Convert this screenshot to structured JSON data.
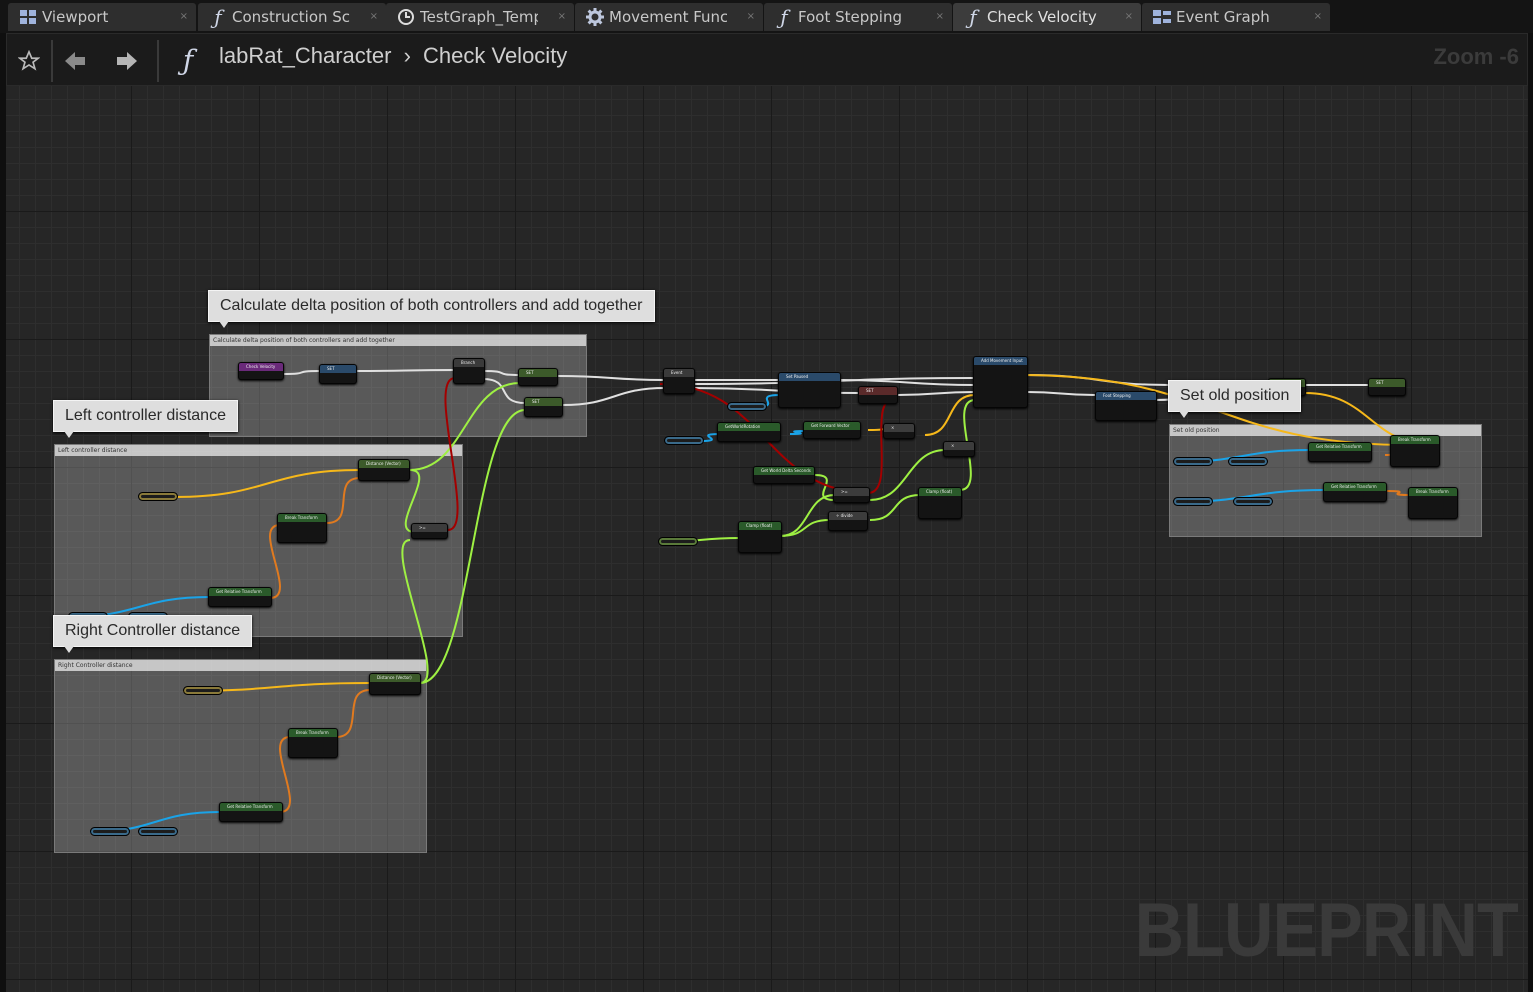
{
  "tabs": [
    {
      "label": "Viewport",
      "icon": "viewport-icon",
      "active": false
    },
    {
      "label": "Construction Scrip",
      "icon": "function-icon",
      "active": false
    },
    {
      "label": "TestGraph_Templa",
      "icon": "clock-icon",
      "active": false
    },
    {
      "label": "Movement Functic",
      "icon": "gear-icon",
      "active": false
    },
    {
      "label": "Foot Stepping",
      "icon": "function-icon",
      "active": false
    },
    {
      "label": "Check Velocity",
      "icon": "function-icon",
      "active": true
    },
    {
      "label": "Event Graph",
      "icon": "event-graph-icon",
      "active": false
    }
  ],
  "toolbar": {
    "breadcrumb_root": "labRat_Character",
    "breadcrumb_current": "Check Velocity",
    "zoom": "Zoom -6"
  },
  "comments": [
    {
      "bubble": "Calculate delta position of both controllers and add together",
      "header": "Calculate delta position of both controllers and add together"
    },
    {
      "bubble": "Left controller distance",
      "header": "Left controller distance"
    },
    {
      "bubble": "Right Controller distance",
      "header": "Right Controller distance"
    },
    {
      "bubble": "Set old position",
      "header": "Set old position"
    }
  ],
  "nodes": {
    "check_velocity": "Check Velocity",
    "set": "SET",
    "branch": "Branch",
    "distance": "Distance (Vector)",
    "break_transform": "Break Transform",
    "get_relative_transform": "Get Relative Transform",
    "greater_equal": ">=",
    "event": "Event",
    "set_paused": "Set Paused",
    "add_movement_input": "Add Movement Input",
    "foot_stepping": "Foot Stepping",
    "get_world_rotation": "GetWorldRotation",
    "get_forward_vector": "Get Forward Vector",
    "set_world_delta_seconds": "Get World Delta Seconds",
    "clamp_float": "Clamp (float)",
    "multiply": "×",
    "divide": "÷ divide"
  },
  "colors": {
    "exec_wire": "#e0e0e0",
    "vector_wire": "#f6b81a",
    "float_wire": "#9ef043",
    "transform_wire": "#e07a1f",
    "object_wire": "#1aa3e8",
    "bool_wire": "#a30000"
  },
  "watermark": "BLUEPRINT"
}
